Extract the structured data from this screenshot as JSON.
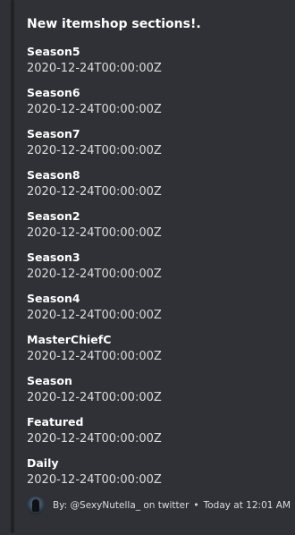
{
  "embed": {
    "title": "New itemshop sections!.",
    "fields": [
      {
        "name": "Season5",
        "value": "2020-12-24T00:00:00Z"
      },
      {
        "name": "Season6",
        "value": "2020-12-24T00:00:00Z"
      },
      {
        "name": "Season7",
        "value": "2020-12-24T00:00:00Z"
      },
      {
        "name": "Season8",
        "value": "2020-12-24T00:00:00Z"
      },
      {
        "name": "Season2",
        "value": "2020-12-24T00:00:00Z"
      },
      {
        "name": "Season3",
        "value": "2020-12-24T00:00:00Z"
      },
      {
        "name": "Season4",
        "value": "2020-12-24T00:00:00Z"
      },
      {
        "name": "MasterChiefC",
        "value": "2020-12-24T00:00:00Z"
      },
      {
        "name": "Season",
        "value": "2020-12-24T00:00:00Z"
      },
      {
        "name": "Featured",
        "value": "2020-12-24T00:00:00Z"
      },
      {
        "name": "Daily",
        "value": "2020-12-24T00:00:00Z"
      }
    ],
    "footer": {
      "avatar_icon": "footer-avatar-icon",
      "text": "By: @SexyNutella_ on twitter",
      "separator": "•",
      "timestamp": "Today at 12:01 AM"
    },
    "colors": {
      "background": "#2f3136",
      "accent_bar": "#202225",
      "title": "#ffffff",
      "value": "#dcddde"
    }
  }
}
